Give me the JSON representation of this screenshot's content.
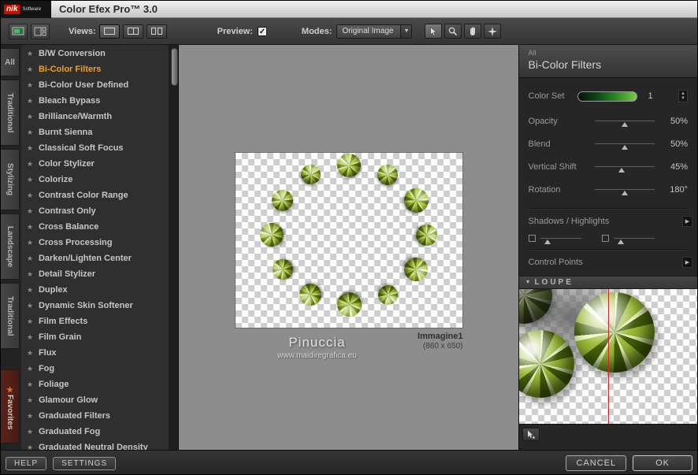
{
  "titlebar": {
    "logo_nik": "nik",
    "logo_software": "Software",
    "title": "Color Efex Pro™ 3.0"
  },
  "toolbar": {
    "views_label": "Views:",
    "preview_label": "Preview:",
    "modes_label": "Modes:",
    "modes_value": "Original Image"
  },
  "tabs": [
    {
      "label": "All"
    },
    {
      "label": "Traditional"
    },
    {
      "label": "Stylizing"
    },
    {
      "label": "Landscape"
    },
    {
      "label": "Traditional"
    },
    {
      "label": "Favorites"
    }
  ],
  "filter_list": {
    "selected": "Bi-Color Filters",
    "items": [
      "B/W Conversion",
      "Bi-Color Filters",
      "Bi-Color User Defined",
      "Bleach Bypass",
      "Brilliance/Warmth",
      "Burnt Sienna",
      "Classical Soft Focus",
      "Color Stylizer",
      "Colorize",
      "Contrast Color Range",
      "Contrast Only",
      "Cross Balance",
      "Cross Processing",
      "Darken/Lighten Center",
      "Detail Stylizer",
      "Duplex",
      "Dynamic Skin Softener",
      "Film Effects",
      "Film Grain",
      "Flux",
      "Fog",
      "Foliage",
      "Glamour Glow",
      "Graduated Filters",
      "Graduated Fog",
      "Graduated Neutral Density"
    ]
  },
  "canvas": {
    "caption_title": "Pinuccia",
    "caption_url": "www.maidiregrafica.eu",
    "image_label": "Immagine1",
    "image_size": "(860 x 650)"
  },
  "panel": {
    "category": "All",
    "title": "Bi-Color Filters",
    "color_set": {
      "label": "Color Set",
      "value": "1"
    },
    "sliders": [
      {
        "label": "Opacity",
        "value": "50%",
        "pos": 50
      },
      {
        "label": "Blend",
        "value": "50%",
        "pos": 50
      },
      {
        "label": "Vertical Shift",
        "value": "45%",
        "pos": 45
      },
      {
        "label": "Rotation",
        "value": "180°",
        "pos": 50
      }
    ],
    "shadows_highlights_label": "Shadows / Highlights",
    "control_points_label": "Control Points",
    "loupe_label": "LOUPE"
  },
  "footer": {
    "help": "HELP",
    "settings": "SETTINGS",
    "cancel": "CANCEL",
    "ok": "OK"
  },
  "colors": {
    "accent_orange": "#f09f2e",
    "flower_green": "#93b02c",
    "loupe_split_line": "#cc2a2a"
  }
}
